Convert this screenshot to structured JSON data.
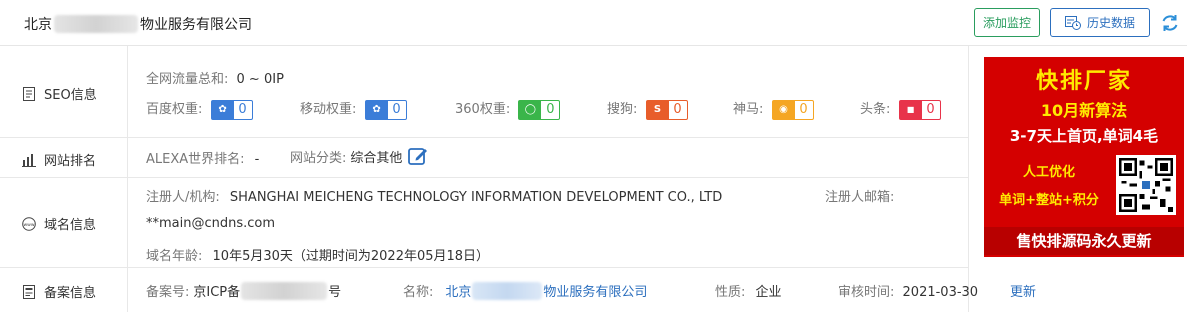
{
  "header": {
    "company_prefix": "北京",
    "company_suffix": "物业服务有限公司",
    "btn_monitor": "添加监控",
    "btn_history": "历史数据"
  },
  "seo": {
    "label": "SEO信息",
    "traffic_label": "全网流量总和:",
    "traffic_value": "0 ~ 0IP",
    "weights": [
      {
        "label": "百度权重:",
        "value": "0",
        "color": "#3b7dd8"
      },
      {
        "label": "移动权重:",
        "value": "0",
        "color": "#3b7dd8"
      },
      {
        "label": "360权重:",
        "value": "0",
        "color": "#3ab54a"
      },
      {
        "label": "搜狗:",
        "value": "0",
        "color": "#e85d2a"
      },
      {
        "label": "神马:",
        "value": "0",
        "color": "#f5a623"
      },
      {
        "label": "头条:",
        "value": "0",
        "color": "#e8334a"
      }
    ]
  },
  "rank": {
    "label": "网站排名",
    "alexa_label": "ALEXA世界排名:",
    "alexa_value": "-",
    "category_label": "网站分类:",
    "category_value": "综合其他"
  },
  "domain": {
    "label": "域名信息",
    "registrant_label": "注册人/机构:",
    "registrant_value": "SHANGHAI MEICHENG TECHNOLOGY INFORMATION DEVELOPMENT CO., LTD",
    "email_label": "注册人邮箱:",
    "email_value": "**main@cndns.com",
    "age_label": "域名年龄:",
    "age_value": "10年5月30天（过期时间为2022年05月18日）"
  },
  "icp": {
    "label": "备案信息",
    "number_label": "备案号:",
    "number_prefix": "京ICP备",
    "number_suffix": "号",
    "name_label": "名称:",
    "name_prefix": "北京",
    "name_suffix": "物业服务有限公司",
    "nature_label": "性质:",
    "nature_value": "企业",
    "audit_label": "审核时间:",
    "audit_value": "2021-03-30",
    "update_label": "更新"
  },
  "ad": {
    "line1": "快排厂家",
    "line2": "10月新算法",
    "line3": "3-7天上首页,单词4毛",
    "line4": "人工优化",
    "line5": "单词+整站+积分",
    "line6": "售快排源码永久更新",
    "bg": "#d40000",
    "text": "#ffea00"
  }
}
